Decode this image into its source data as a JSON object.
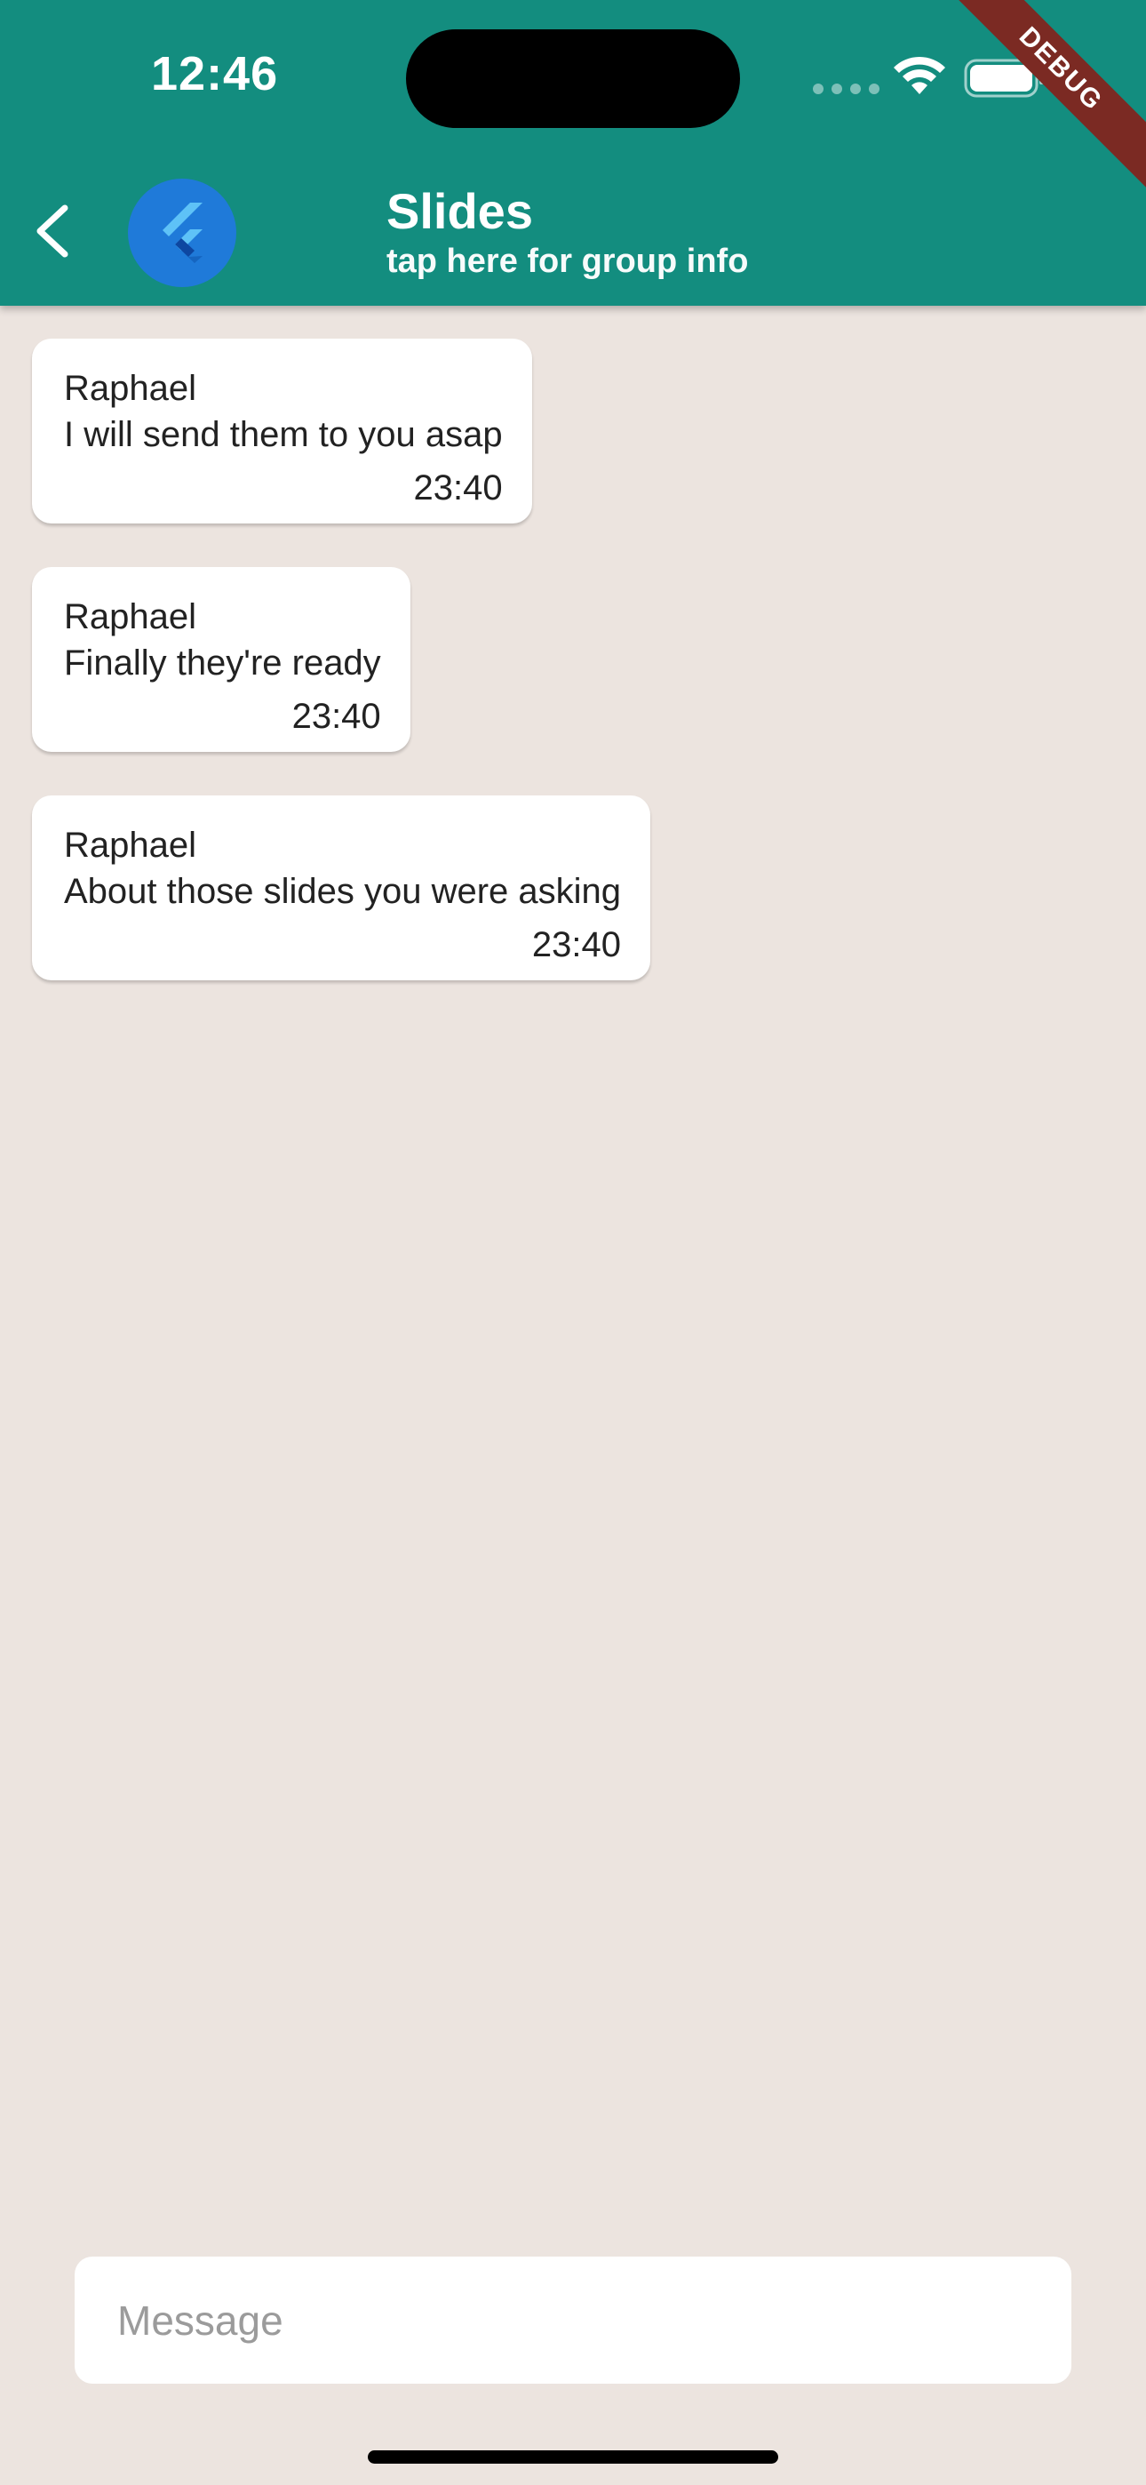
{
  "status_bar": {
    "time": "12:46"
  },
  "debug_banner": "DEBUG",
  "header": {
    "title": "Slides",
    "subtitle": "tap here for group info",
    "avatar_icon": "flutter-logo-icon",
    "back_icon": "chevron-left-icon"
  },
  "messages": [
    {
      "sender": "Raphael",
      "text": "I will send them to you asap",
      "time": "23:40"
    },
    {
      "sender": "Raphael",
      "text": "Finally they're ready",
      "time": "23:40"
    },
    {
      "sender": "Raphael",
      "text": "About those slides you were asking",
      "time": "23:40"
    }
  ],
  "composer": {
    "placeholder": "Message"
  },
  "colors": {
    "header": "#138d7f",
    "background": "#ece4df",
    "bubble": "#ffffff",
    "avatar": "#1f7ad9"
  }
}
